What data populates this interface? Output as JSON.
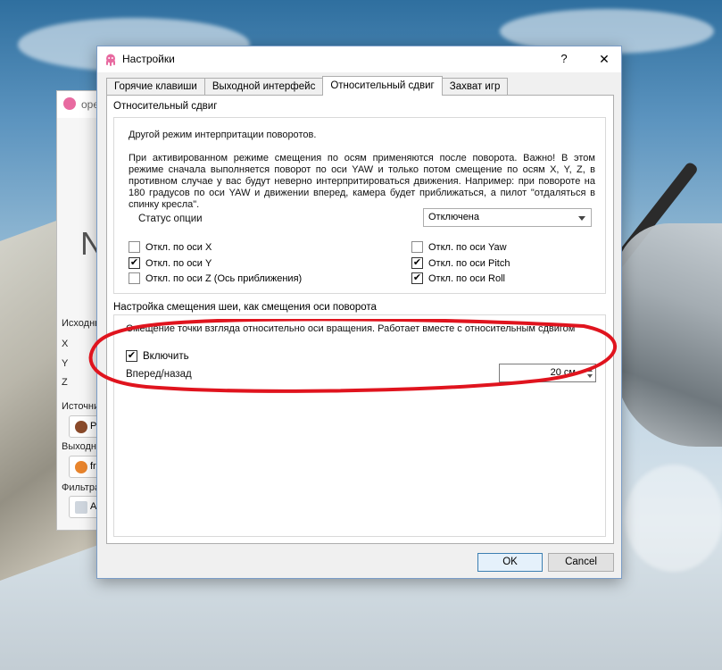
{
  "background_window": {
    "title": "ope",
    "big_letter": "N",
    "source_section_label": "Исходны",
    "axis_x": "X",
    "axis_y": "Y",
    "axis_z": "Z",
    "input_label": "Источни",
    "input_value": "Р",
    "output_label": "Выходн",
    "output_value": "fr",
    "filter_label": "Фильтра",
    "filter_value": "А"
  },
  "dialog": {
    "title": "Настройки",
    "help_glyph": "?",
    "close_glyph": "✕",
    "tabs": [
      {
        "label": "Горячие клавиши"
      },
      {
        "label": "Выходной интерфейс"
      },
      {
        "label": "Относительный сдвиг"
      },
      {
        "label": "Захват игр"
      }
    ],
    "active_tab": "Относительный сдвиг",
    "relative_shift": {
      "group_title": "Относительный сдвиг",
      "description_1": "Другой режим интерпритации поворотов.",
      "description_2": "При активированном режиме смещения по осям применяются после поворота. Важно! В этом режиме сначала выполняется поворот по оси YAW и только потом смещение по осям X, Y, Z, в противном случае у вас будут неверно интерпритироваться движения. Например: при повороте на 180 градусов по оси YAW и движении вперед, камера будет приближаться, а пилот \"отдаляться в спинку кресла\".",
      "status_label": "Статус опции",
      "status_value": "Отключена",
      "checkboxes_left": [
        {
          "label": "Откл. по оси X",
          "checked": false
        },
        {
          "label": "Откл. по оси Y",
          "checked": true
        },
        {
          "label": "Откл. по оси Z (Ось приближения)",
          "checked": false
        }
      ],
      "checkboxes_right": [
        {
          "label": "Откл. по оси Yaw",
          "checked": false
        },
        {
          "label": "Откл. по оси Pitch",
          "checked": true
        },
        {
          "label": "Откл. по оси Roll",
          "checked": true
        }
      ]
    },
    "neck_offset": {
      "group_title": "Настройка смещения шеи, как смещения оси поворота",
      "description": "Смещение точки взгляда относительно оси вращения. Работает вместе с относительным сдвигом",
      "enable_label": "Включить",
      "enable_checked": true,
      "forward_label": "Вперед/назад",
      "forward_value": "20 см"
    },
    "check_mark": "✔",
    "ok_label": "OK",
    "cancel_label": "Cancel"
  },
  "colors": {
    "annotation_red": "#e0141e",
    "accent_blue": "#3c7fb1"
  }
}
